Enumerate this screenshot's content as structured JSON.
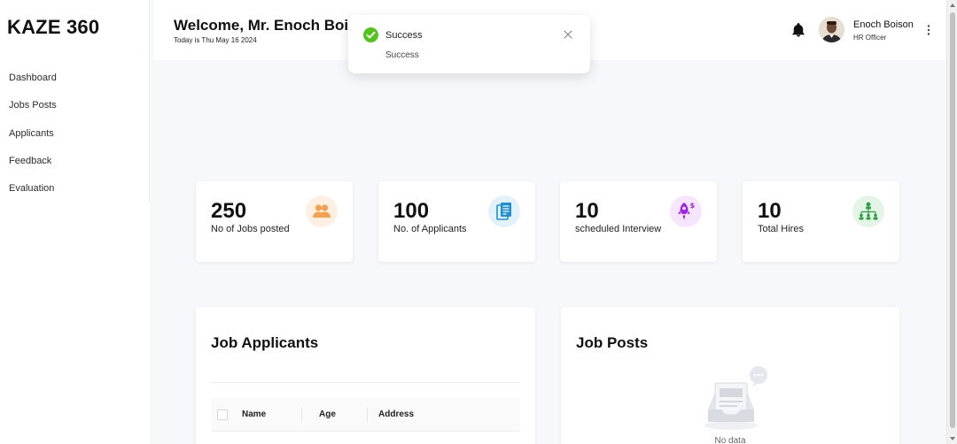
{
  "sidebar": {
    "brand": "KAZE 360",
    "items": [
      {
        "label": "Dashboard"
      },
      {
        "label": "Jobs Posts"
      },
      {
        "label": "Applicants"
      },
      {
        "label": "Feedback"
      },
      {
        "label": "Evaluation"
      }
    ]
  },
  "header": {
    "welcome": "Welcome, Mr. Enoch Boison",
    "today": "Today is Thu May 16 2024",
    "user_name": "Enoch Boison",
    "user_role": "HR Officer"
  },
  "toast": {
    "title": "Success",
    "message": "Success",
    "status_color": "#52c41a"
  },
  "stats": [
    {
      "value": "250",
      "label": "No of Jobs posted",
      "icon": "users-icon",
      "color": "#f5a14b"
    },
    {
      "value": "100",
      "label": "No. of Applicants",
      "icon": "document-icon",
      "color": "#1e8fd5"
    },
    {
      "value": "10",
      "label": "scheduled Interview",
      "icon": "rocket-icon",
      "color": "#a020f0"
    },
    {
      "value": "10",
      "label": "Total Hires",
      "icon": "org-chart-icon",
      "color": "#2e9e44"
    }
  ],
  "applicants_panel": {
    "title": "Job Applicants",
    "columns": [
      "Name",
      "Age",
      "Address"
    ]
  },
  "jobposts_panel": {
    "title": "Job Posts",
    "empty_text": "No data"
  }
}
